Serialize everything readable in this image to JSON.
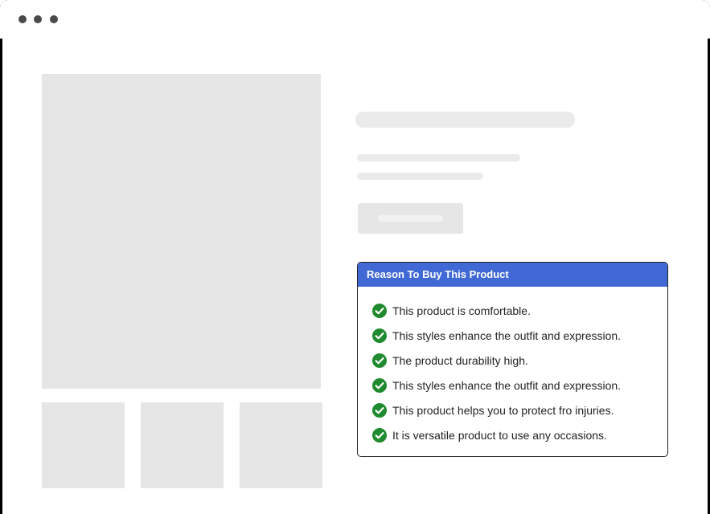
{
  "window": {
    "controls": [
      "dot",
      "dot",
      "dot"
    ],
    "control_color": "#4a4a4a"
  },
  "reasons_card": {
    "title": "Reason To Buy This Product",
    "header_color": "#4169d6",
    "check_icon": "check-circle-icon",
    "check_color": "#1f8a2e",
    "items": [
      "This product is comfortable.",
      "This styles enhance the outfit and expression.",
      "The product durability high.",
      "This styles enhance the outfit and expression.",
      "This product helps you to protect fro injuries.",
      "It is versatile product to use any occasions."
    ]
  }
}
